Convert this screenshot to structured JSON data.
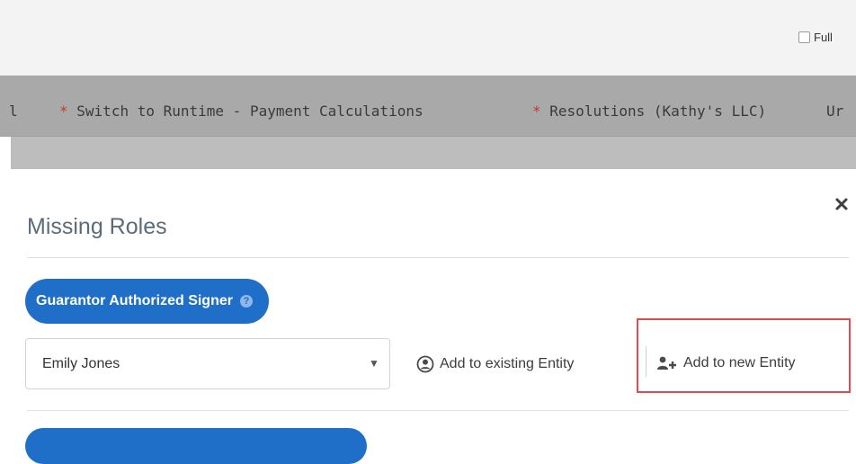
{
  "header": {
    "full_label": "Full"
  },
  "tabs": [
    {
      "prefix": "",
      "label": "l"
    },
    {
      "prefix": "*",
      "label": "Switch to Runtime - Payment Calculations"
    },
    {
      "prefix": "*",
      "label": "Resolutions (Kathy's LLC)"
    },
    {
      "prefix": "",
      "label": "Ur"
    }
  ],
  "modal": {
    "title": "Missing Roles",
    "role_pill": "Guarantor Authorized Signer",
    "selected_person": "Emily Jones",
    "add_existing_label": "Add to existing Entity",
    "add_new_label": "Add to new Entity"
  },
  "colors": {
    "accent": "#1f6fc9",
    "highlight": "#e24a4f",
    "tabbar": "#a9a9a9"
  },
  "icons": {
    "close": "close-icon",
    "help": "help-icon",
    "existing": "user-circle-icon",
    "new": "user-plus-icon"
  }
}
